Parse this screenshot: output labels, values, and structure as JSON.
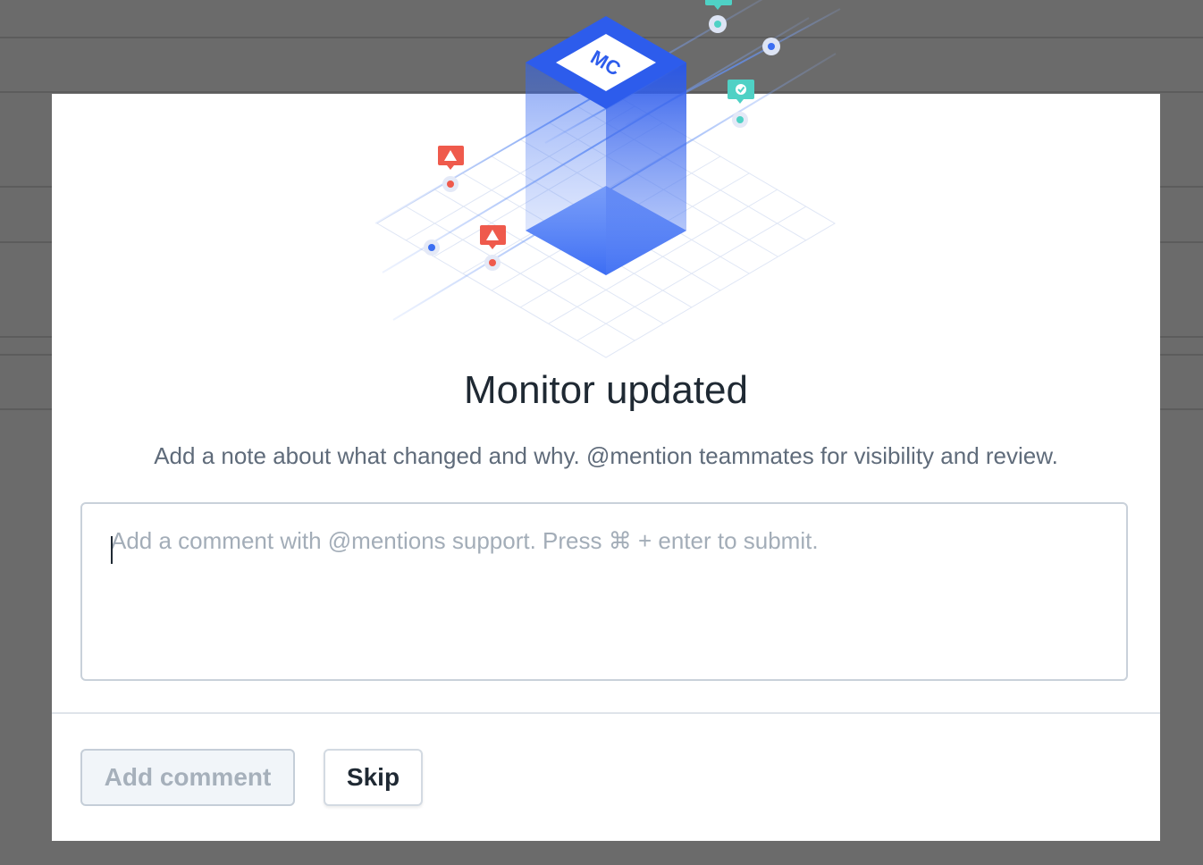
{
  "modal": {
    "title": "Monitor updated",
    "subtitle": "Add a note about what changed and why. @mention teammates for visibility and review.",
    "comment": {
      "value": "",
      "placeholder": "Add a comment with @mentions support. Press ⌘ + enter to submit."
    },
    "buttons": {
      "add_comment_label": "Add comment",
      "skip_label": "Skip"
    }
  },
  "illustration": {
    "logo_text": "MC",
    "icons": [
      "warning-icon",
      "warning-icon",
      "check-icon",
      "check-icon"
    ]
  },
  "colors": {
    "overlay": "#6b6b6b",
    "accent_blue": "#2f63f0",
    "alert_red": "#ef5a4c",
    "ok_teal": "#4fd1c5"
  }
}
